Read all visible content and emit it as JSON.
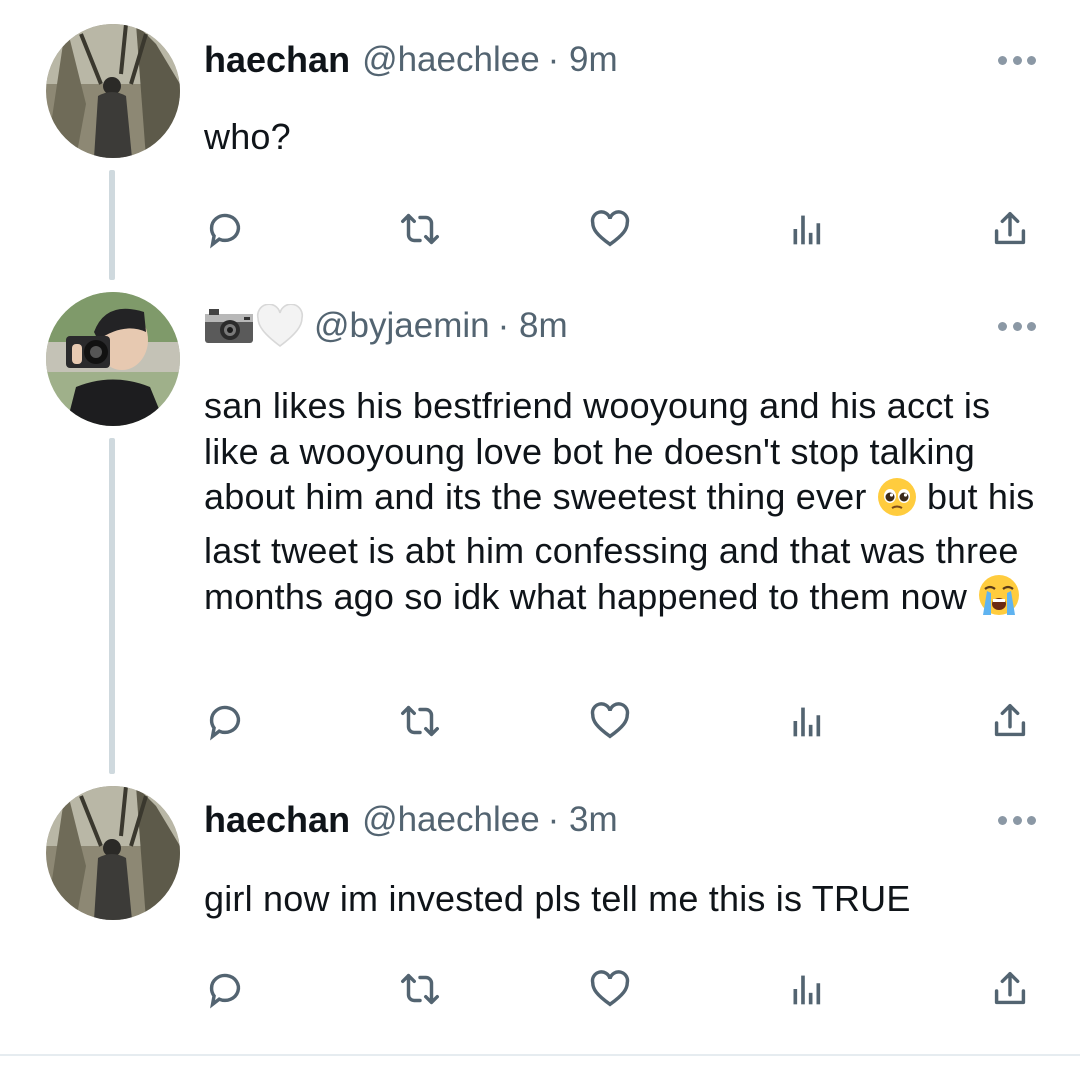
{
  "tweets": [
    {
      "name": "haechan",
      "handle": "@haechlee",
      "time": "· 9m",
      "text": "who?"
    },
    {
      "name": "",
      "name_icons": [
        "camera-emoji",
        "white-heart-emoji"
      ],
      "handle": "@byjaemin",
      "time": "· 8m",
      "text_parts": [
        "san likes his bestfriend wooyoung and his acct is like a wooyoung love bot he doesn't stop talking about him and its the sweetest thing ever ",
        " but his last tweet is abt him confessing and that was three months ago so idk what happened to them now "
      ],
      "emojis": [
        "pleading-face-emoji",
        "loudly-crying-face-emoji"
      ]
    },
    {
      "name": "haechan",
      "handle": "@haechlee",
      "time": "· 3m",
      "text": "girl now im invested pls tell me this is TRUE"
    }
  ],
  "action_icons": [
    "reply-icon",
    "retweet-icon",
    "like-icon",
    "analytics-icon",
    "share-icon"
  ],
  "colors": {
    "icon": "#536471",
    "thread_line": "#cfd9de",
    "text": "#0f1419"
  }
}
